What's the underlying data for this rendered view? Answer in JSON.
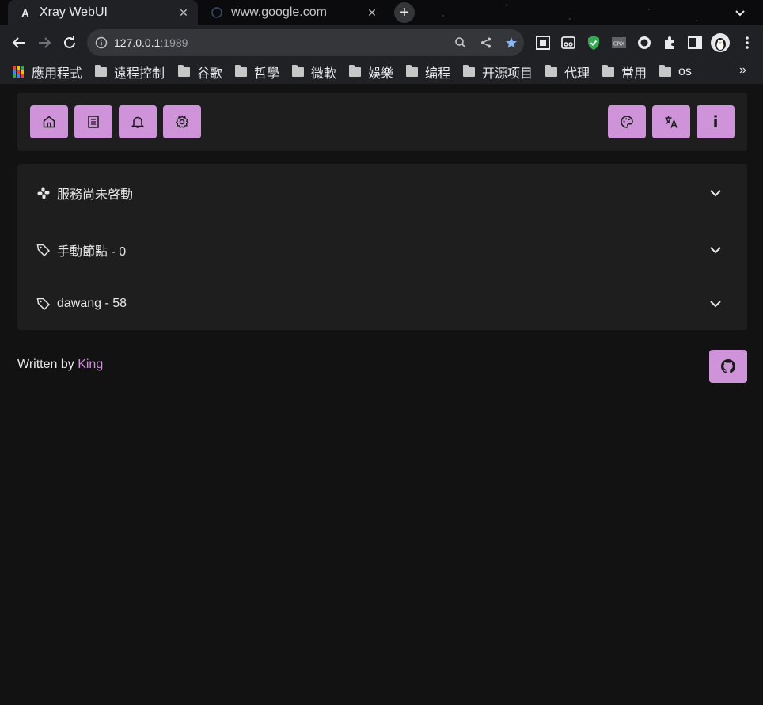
{
  "browser": {
    "tabs": [
      {
        "title": "Xray WebUI",
        "favicon": "A",
        "active": true
      },
      {
        "title": "www.google.com",
        "favicon": "globe-icon",
        "active": false
      }
    ],
    "new_tab_label": "+",
    "address": {
      "host": "127.0.0.1",
      "port": ":1989"
    },
    "bookmarks": [
      {
        "label": "應用程式",
        "kind": "apps"
      },
      {
        "label": "遠程控制",
        "kind": "folder"
      },
      {
        "label": "谷歌",
        "kind": "folder"
      },
      {
        "label": "哲學",
        "kind": "folder"
      },
      {
        "label": "微軟",
        "kind": "folder"
      },
      {
        "label": "娛樂",
        "kind": "folder"
      },
      {
        "label": "编程",
        "kind": "folder"
      },
      {
        "label": "开源项目",
        "kind": "folder"
      },
      {
        "label": "代理",
        "kind": "folder"
      },
      {
        "label": "常用",
        "kind": "folder"
      },
      {
        "label": "os",
        "kind": "folder"
      }
    ],
    "bookmarks_more": "»"
  },
  "appbar": {
    "left_buttons": [
      "home-icon",
      "log-icon",
      "notification-icon",
      "settings-icon"
    ],
    "right_buttons": [
      "palette-icon",
      "translate-icon",
      "info-icon"
    ],
    "info_glyph": "i"
  },
  "panels": [
    {
      "icon": "cluster-icon",
      "title": "服務尚未啓動"
    },
    {
      "icon": "tag-icon",
      "title": "手動節點 - 0"
    },
    {
      "icon": "tag-icon",
      "title": "dawang - 58"
    }
  ],
  "footer": {
    "written_by": "Written by",
    "author": "King"
  },
  "colors": {
    "accent": "#ce93d8",
    "background": "#121212",
    "surface": "#1e1e1e"
  }
}
